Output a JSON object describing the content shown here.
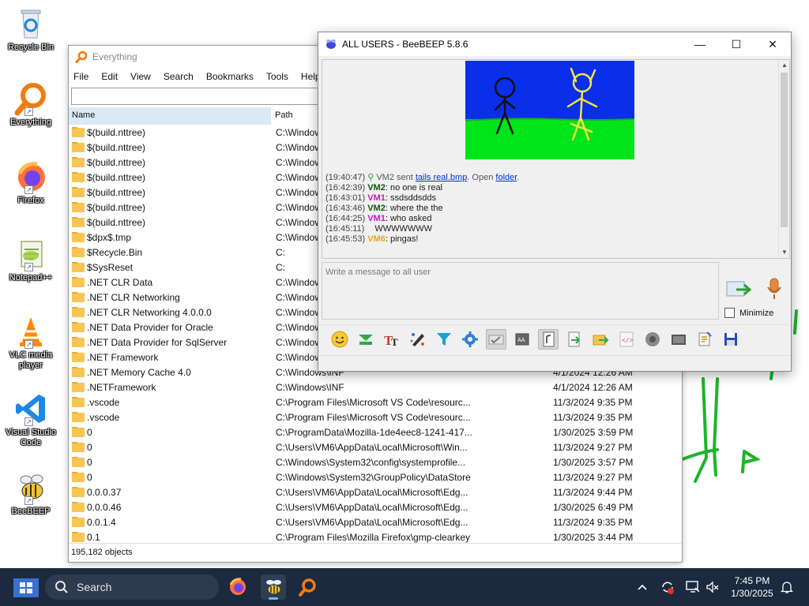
{
  "desktop": {
    "icons": [
      {
        "label": "Recycle Bin"
      },
      {
        "label": "Everything"
      },
      {
        "label": "Firefox"
      },
      {
        "label": "Notepad++"
      },
      {
        "label": "VLC media player"
      },
      {
        "label": "Visual Studio Code"
      },
      {
        "label": "BeeBEEP"
      }
    ]
  },
  "everything": {
    "title": "Everything",
    "menu": [
      "File",
      "Edit",
      "View",
      "Search",
      "Bookmarks",
      "Tools",
      "Help"
    ],
    "search_value": "",
    "columns": {
      "name": "Name",
      "path": "Path"
    },
    "rows": [
      {
        "name": "$(build.nttree)",
        "path": "C:\\Windows",
        "date": ""
      },
      {
        "name": "$(build.nttree)",
        "path": "C:\\Windows",
        "date": ""
      },
      {
        "name": "$(build.nttree)",
        "path": "C:\\Windows",
        "date": ""
      },
      {
        "name": "$(build.nttree)",
        "path": "C:\\Windows",
        "date": ""
      },
      {
        "name": "$(build.nttree)",
        "path": "C:\\Windows",
        "date": ""
      },
      {
        "name": "$(build.nttree)",
        "path": "C:\\Windows",
        "date": ""
      },
      {
        "name": "$(build.nttree)",
        "path": "C:\\Windows",
        "date": ""
      },
      {
        "name": "$dpx$.tmp",
        "path": "C:\\Windows",
        "date": ""
      },
      {
        "name": "$Recycle.Bin",
        "path": "C:",
        "date": ""
      },
      {
        "name": "$SysReset",
        "path": "C:",
        "date": ""
      },
      {
        "name": ".NET CLR Data",
        "path": "C:\\Windows",
        "date": ""
      },
      {
        "name": ".NET CLR Networking",
        "path": "C:\\Windows",
        "date": ""
      },
      {
        "name": ".NET CLR Networking 4.0.0.0",
        "path": "C:\\Windows",
        "date": ""
      },
      {
        "name": ".NET Data Provider for Oracle",
        "path": "C:\\Windows",
        "date": ""
      },
      {
        "name": ".NET Data Provider for SqlServer",
        "path": "C:\\Windows",
        "date": ""
      },
      {
        "name": ".NET Framework",
        "path": "C:\\Windows",
        "date": ""
      },
      {
        "name": ".NET Memory Cache 4.0",
        "path": "C:\\Windows\\INF",
        "date": "4/1/2024 12:26 AM"
      },
      {
        "name": ".NETFramework",
        "path": "C:\\Windows\\INF",
        "date": "4/1/2024 12:26 AM"
      },
      {
        "name": ".vscode",
        "path": "C:\\Program Files\\Microsoft VS Code\\resourc...",
        "date": "11/3/2024 9:35 PM"
      },
      {
        "name": ".vscode",
        "path": "C:\\Program Files\\Microsoft VS Code\\resourc...",
        "date": "11/3/2024 9:35 PM"
      },
      {
        "name": "0",
        "path": "C:\\ProgramData\\Mozilla-1de4eec8-1241-417...",
        "date": "1/30/2025 3:59 PM"
      },
      {
        "name": "0",
        "path": "C:\\Users\\VM6\\AppData\\Local\\Microsoft\\Win...",
        "date": "11/3/2024 9:27 PM"
      },
      {
        "name": "0",
        "path": "C:\\Windows\\System32\\config\\systemprofile...",
        "date": "1/30/2025 3:57 PM"
      },
      {
        "name": "0",
        "path": "C:\\Windows\\System32\\GroupPolicy\\DataStore",
        "date": "11/3/2024 9:27 PM"
      },
      {
        "name": "0.0.0.37",
        "path": "C:\\Users\\VM6\\AppData\\Local\\Microsoft\\Edg...",
        "date": "11/3/2024 9:44 PM"
      },
      {
        "name": "0.0.0.46",
        "path": "C:\\Users\\VM6\\AppData\\Local\\Microsoft\\Edg...",
        "date": "1/30/2025 6:49 PM"
      },
      {
        "name": "0.0.1.4",
        "path": "C:\\Users\\VM6\\AppData\\Local\\Microsoft\\Edg...",
        "date": "11/3/2024 9:35 PM"
      },
      {
        "name": "0.1",
        "path": "C:\\Program Files\\Mozilla Firefox\\gmp-clearkey",
        "date": "1/30/2025 3:44 PM"
      }
    ],
    "status": "195,182 objects"
  },
  "beebeep": {
    "title": "ALL USERS - BeeBEEP 5.8.6",
    "file_message": {
      "time": "(19:40:47)",
      "sender_text": "VM2 sent",
      "file": "tails real.bmp",
      "open_text": ". Open",
      "folder": "folder",
      "end": "."
    },
    "messages": [
      {
        "time": "(16:42:39)",
        "user": "VM2",
        "text": ": no one is real",
        "cls": "u-vm2"
      },
      {
        "time": "(16:43:01)",
        "user": "VM1",
        "text": ": ssdsddsdds",
        "cls": "u-vm1"
      },
      {
        "time": "(16:43:46)",
        "user": "VM2",
        "text": ": where the the",
        "cls": "u-vm2"
      },
      {
        "time": "(16:44:25)",
        "user": "VM1",
        "text": ": who asked",
        "cls": "u-vm1"
      },
      {
        "time": "(16:45:11)",
        "user": "",
        "text": "WWWWWWW",
        "cls": ""
      },
      {
        "time": "(16:45:53)",
        "user": "VM6",
        "text": ": pingas!",
        "cls": "u-vm6"
      }
    ],
    "input_placeholder": "Write a message to all user",
    "minimize_label": "Minimize",
    "minimize_checked": false,
    "toolbar_icons": [
      "emoticon-icon",
      "expand-icon",
      "text-font-icon",
      "color-pencil-icon",
      "filter-icon",
      "settings-gear-icon",
      "spell-check-icon",
      "keyboard-icon",
      "note-icon",
      "send-file-icon",
      "send-folder-icon",
      "code-icon",
      "record-icon",
      "screenshot-icon",
      "clear-icon",
      "save-icon"
    ],
    "toolbar_active": [
      6,
      8
    ]
  },
  "taskbar": {
    "search_label": "Search",
    "time": "7:45 PM",
    "date": "1/30/2025"
  }
}
